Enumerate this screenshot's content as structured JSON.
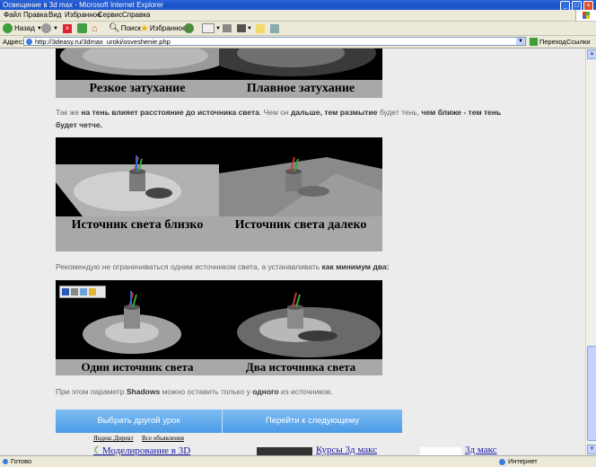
{
  "window": {
    "title": "Освещение в 3d max - Microsoft Internet Explorer"
  },
  "menu": [
    "Файл",
    "Правка",
    "Вид",
    "Избранное",
    "Сервис",
    "Справка"
  ],
  "toolbar": {
    "back": "Назад",
    "search": "Поиск",
    "favorites": "Избранное"
  },
  "address": {
    "label": "Адрес:",
    "url": "http://3deasy.ru/3dmax_uroki/osveshenie.php",
    "go": "Переход",
    "links": "Ссылки"
  },
  "content": {
    "row1": {
      "left_caption": "Резкое затухание",
      "right_caption": "Плавное затухание"
    },
    "para1": {
      "p1": "Так же ",
      "b1": "на тень влияет расстояние до источника света",
      "p2": ". Чем он ",
      "b2": "дальше, тем размытие",
      "p3": " будет тень, ",
      "b3": "чем ближе - тем тень будет четче."
    },
    "row2": {
      "left_caption": "Источник света близко",
      "right_caption": "Источник света далеко"
    },
    "para2": {
      "p1": "Рекомендую не ограничиваться одним источником света, а устанавливать ",
      "b1": "как минимум два:"
    },
    "row3": {
      "left_caption": "Один источник света",
      "right_caption": "Два источника света"
    },
    "para3": {
      "p1": "При этом параметр ",
      "b1": "Shadows",
      "p2": " можно оставить только у ",
      "b2": "одного",
      "p3": " из источников."
    },
    "buttons": {
      "prev": "Выбрать другой урок",
      "next": "Перейти к следующему"
    },
    "ads": {
      "direct": "Яндекс.Директ",
      "all": "Все объявления",
      "ad1": "Моделирование в 3D",
      "ad2": "Курсы 3д макс",
      "ad3": "3д макс"
    }
  },
  "status": {
    "left": "Готово",
    "right": "Интернет"
  }
}
